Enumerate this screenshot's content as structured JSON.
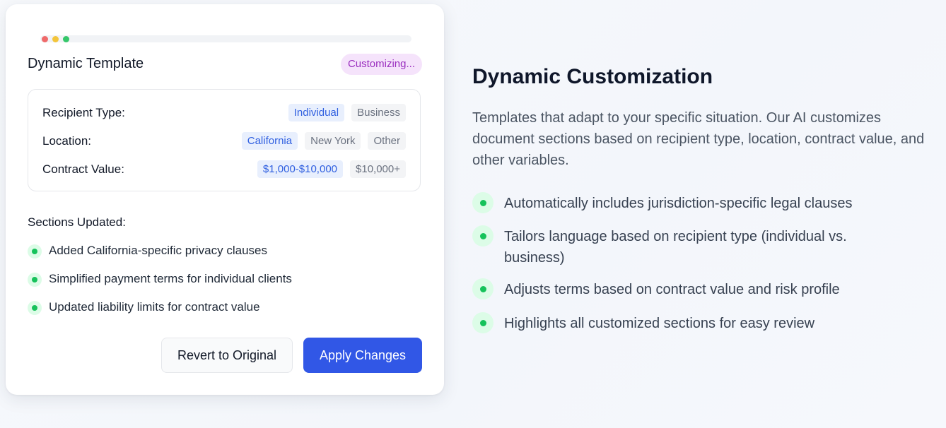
{
  "card": {
    "title": "Dynamic Template",
    "status_badge": "Customizing...",
    "options": [
      {
        "label": "Recipient Type:",
        "choices": [
          "Individual",
          "Business"
        ],
        "selected": "Individual"
      },
      {
        "label": "Location:",
        "choices": [
          "California",
          "New York",
          "Other"
        ],
        "selected": "California"
      },
      {
        "label": "Contract Value:",
        "choices": [
          "$1,000-$10,000",
          "$10,000+"
        ],
        "selected": "$1,000-$10,000"
      }
    ],
    "sections_title": "Sections Updated:",
    "sections": [
      "Added California-specific privacy clauses",
      "Simplified payment terms for individual clients",
      "Updated liability limits for contract value"
    ],
    "revert_label": "Revert to Original",
    "apply_label": "Apply Changes"
  },
  "feature": {
    "heading": "Dynamic Customization",
    "description": "Templates that adapt to your specific situation. Our AI customizes document sections based on recipient type, location, contract value, and other variables.",
    "bullets": [
      "Automatically includes jurisdiction-specific legal clauses",
      "Tailors language based on recipient type (individual vs. business)",
      "Adjusts terms based on contract value and risk profile",
      "Highlights all customized sections for easy review"
    ]
  },
  "colors": {
    "accent": "#3157e6",
    "badge_text": "#9b2fbf",
    "check_green": "#16c25b"
  },
  "icons": {
    "window_dots": [
      "close-dot",
      "minimize-dot",
      "maximize-dot"
    ],
    "bullet": "check-dot-icon"
  }
}
